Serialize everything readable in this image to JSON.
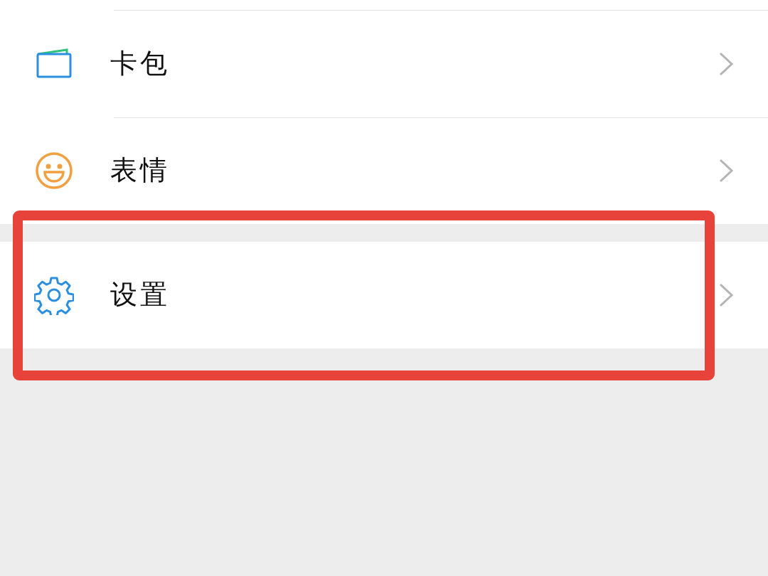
{
  "groups": [
    {
      "items": [
        {
          "kind": "wallet",
          "label": "卡包",
          "highlighted": false
        },
        {
          "kind": "smiley",
          "label": "表情",
          "highlighted": false
        }
      ]
    },
    {
      "items": [
        {
          "kind": "gear",
          "label": "设置",
          "highlighted": true
        }
      ]
    }
  ]
}
